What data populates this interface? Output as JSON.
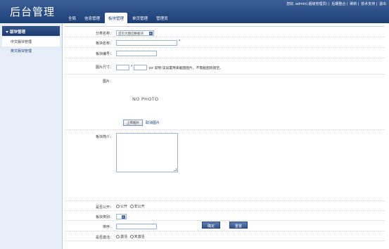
{
  "header": {
    "logo": "后台管理",
    "greeting": "您好",
    "user": "admin",
    "role": "超级管理员",
    "links": [
      "后期整合",
      "刷新",
      "技术支持",
      "退出"
    ],
    "nav": [
      "全局",
      "信息管理",
      "板块管理",
      "单页管理",
      "管理员"
    ]
  },
  "sidebar": {
    "title": "版块管理",
    "items": [
      "中文版块管理",
      "英文版块管理"
    ]
  },
  "form": {
    "category_label": "分类名称：",
    "category_value": "首页大图切换板块",
    "name_label": "板块名称：",
    "name_required": "*",
    "code_label": "板块编号：",
    "size_label": "图片尺寸：",
    "size_sep": "*",
    "size_hint": "px 说明:该设置用来截图图片，不需截图则留空。",
    "image_label": "图片：",
    "no_photo": "NO PHOTO",
    "upload_button": "上传图片",
    "delete_image": "取消图片",
    "intro_label": "板块简介：",
    "public_label": "是否公开：",
    "public_yes": "公开",
    "public_no": "非公开",
    "type_label": "板块类别：",
    "sort_label": "排序：",
    "active_label": "是否激活：",
    "active_yes": "激活",
    "active_no": "未激活",
    "submit": "确定",
    "reset": "重置"
  }
}
